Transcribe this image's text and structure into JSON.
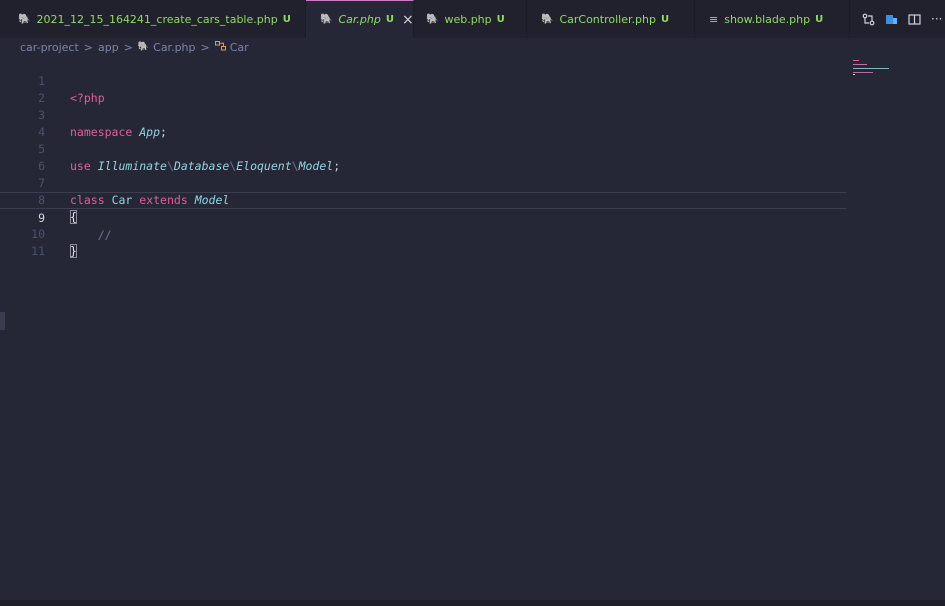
{
  "tabs": [
    {
      "label": "2021_12_15_164241_create_cars_table.php",
      "status": "U",
      "icon": "php-elephant-icon",
      "active": false
    },
    {
      "label": "Car.php",
      "status": "U",
      "icon": "php-elephant-icon",
      "active": true,
      "close": "×"
    },
    {
      "label": "web.php",
      "status": "U",
      "icon": "php-elephant-icon",
      "active": false
    },
    {
      "label": "CarController.php",
      "status": "U",
      "icon": "php-elephant-icon",
      "active": false
    },
    {
      "label": "show.blade.php",
      "status": "U",
      "icon": "lines-icon",
      "active": false
    }
  ],
  "actions": {
    "more": "···"
  },
  "breadcrumb": {
    "project": "car-project",
    "folder": "app",
    "file": "Car.php",
    "symbol": "Car",
    "separator": ">"
  },
  "editor": {
    "line_numbers": [
      "1",
      "2",
      "3",
      "4",
      "5",
      "6",
      "7",
      "8",
      "9",
      "10",
      "11"
    ],
    "current_line": 9,
    "tokens": {
      "php_open": "<?php",
      "namespace_kw": "namespace",
      "namespace_name": "App",
      "semicolon": ";",
      "use_kw": "use",
      "ns_illuminate": "Illuminate",
      "ns_sep": "\\",
      "ns_database": "Database",
      "ns_eloquent": "Eloquent",
      "ns_model": "Model",
      "class_kw": "class",
      "class_name": "Car",
      "extends_kw": "extends",
      "parent_class": "Model",
      "open_brace": "{",
      "comment": "//",
      "close_brace": "}"
    }
  },
  "colors": {
    "background": "#262736",
    "tab_bar": "#20212c",
    "tab_text": "#8fdc5c",
    "keyword": "#e45c9e",
    "class_name": "#8fd7e0",
    "php_icon": "#c07ad6",
    "symbol_icon": "#e89b3a"
  }
}
